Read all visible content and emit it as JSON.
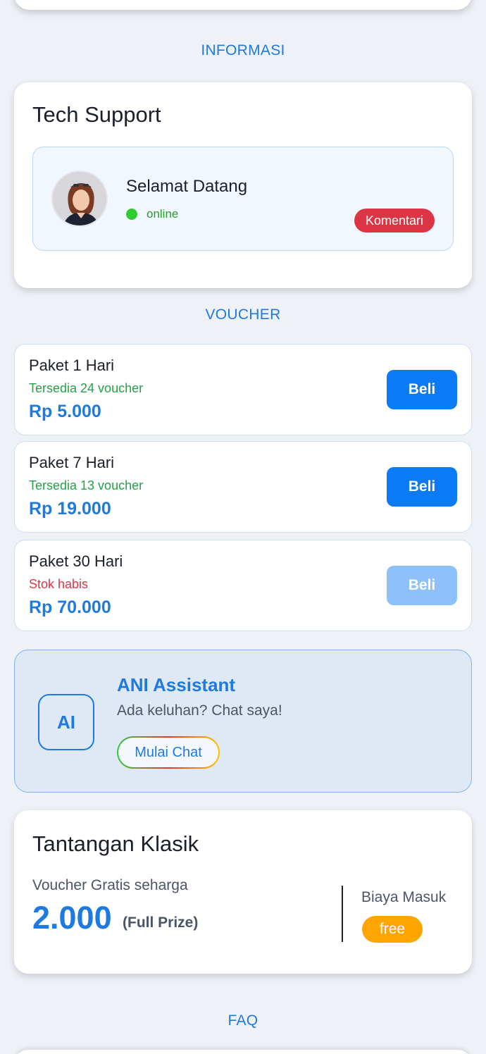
{
  "sections": {
    "informasi": "INFORMASI",
    "voucher": "VOUCHER",
    "faq": "FAQ"
  },
  "tech_support": {
    "title": "Tech Support",
    "name": "Selamat Datang",
    "status": "online",
    "comment_label": "Komentari"
  },
  "vouchers": [
    {
      "name": "Paket 1 Hari",
      "stock": "Tersedia 24 voucher",
      "price": "Rp 5.000",
      "buy_label": "Beli"
    },
    {
      "name": "Paket 7 Hari",
      "stock": "Tersedia 13 voucher",
      "price": "Rp 19.000",
      "buy_label": "Beli"
    },
    {
      "name": "Paket 30 Hari",
      "stock": "Stok habis",
      "price": "Rp 70.000",
      "buy_label": "Beli"
    }
  ],
  "assistant": {
    "badge": "AI",
    "title": "ANI Assistant",
    "subtitle": "Ada keluhan? Chat saya!",
    "chat_label": "Mulai Chat"
  },
  "challenge": {
    "title": "Tantangan Klasik",
    "label": "Voucher Gratis seharga",
    "amount": "2.000",
    "note": "(Full Prize)",
    "fee_label": "Biaya Masuk",
    "fee_value": "free"
  },
  "colors": {
    "accent": "#1f7ae0",
    "online": "#2ecc2e",
    "danger": "#dc3545",
    "free": "#ffa500"
  }
}
